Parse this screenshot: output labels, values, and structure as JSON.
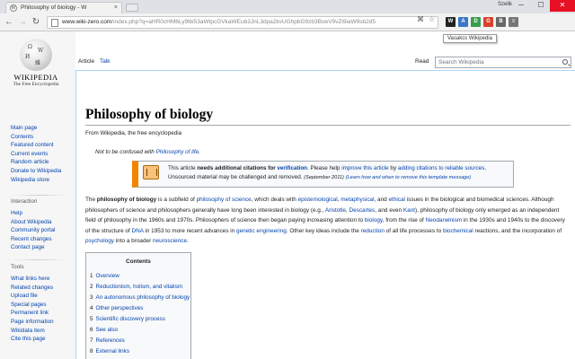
{
  "browser": {
    "tab_title": "Philosophy of biology - W",
    "tab_close": "×",
    "profile_name": "Szelik",
    "win_min": "─",
    "win_max": "☐",
    "win_close": "✕",
    "url_host": "www.wiki-zero.com",
    "url_path": "/index.php?q=aHR0cHM6Ly9lbi53aWtpcGVkaWEub3JnL3dpa2kvUGhpbG9zb3BoeV9vZl9iaW9sb2d5",
    "tooltip": "Vasakcs Wikipedia",
    "extensions": [
      {
        "label": "W",
        "color": "#222222"
      },
      {
        "label": "A",
        "color": "#3b77c8"
      },
      {
        "label": "D",
        "color": "#3a9c4d"
      },
      {
        "label": "G",
        "color": "#d9412a"
      },
      {
        "label": "B",
        "color": "#666666"
      },
      {
        "label": "≡",
        "color": "#777777"
      }
    ]
  },
  "sidebar": {
    "wordmark": "WIKIPEDIA",
    "tagline": "The Free Encyclopedia",
    "nav": [
      "Main page",
      "Contents",
      "Featured content",
      "Current events",
      "Random article",
      "Donate to Wikipedia",
      "Wikipedia store"
    ],
    "interaction_heading": "Interaction",
    "interaction": [
      "Help",
      "About Wikipedia",
      "Community portal",
      "Recent changes",
      "Contact page"
    ],
    "tools_heading": "Tools",
    "tools": [
      "What links here",
      "Related changes",
      "Upload file",
      "Special pages",
      "Permanent link",
      "Page information",
      "Wikidata item",
      "Cite this page"
    ]
  },
  "page_tabs": {
    "article": "Article",
    "talk": "Talk",
    "read": "Read",
    "search_placeholder": "Search Wikipedia"
  },
  "article": {
    "title": "Philosophy of biology",
    "from": "From Wikipedia, the free encyclopedia",
    "hatnote_prefix": "Not to be confused with ",
    "hatnote_link": "Philosophy of life",
    "hatnote_suffix": ".",
    "ambox": {
      "t1": "This article ",
      "t2": "needs additional citations for ",
      "t3": "verification",
      "t4": ". Please help ",
      "t5": "improve this article",
      "t6": " by ",
      "t7": "adding citations to reliable sources",
      "t8": ".",
      "line2": "Unsourced material may be challenged and removed.",
      "date": "(September 2011)",
      "learn": "(Learn how and when to remove this template message)"
    },
    "lead": {
      "s1": "The ",
      "s2": "philosophy of biology",
      "s3": " is a subfield of ",
      "s4": "philosophy of science",
      "s5": ", which deals with ",
      "s6": "epistemological",
      "s7": ", ",
      "s8": "metaphysical",
      "s9": ", and ",
      "s10": "ethical",
      "s11": " issues in the biological and biomedical sciences. Although philosophers of science and philosophers generally have long been interested in biology (e.g., ",
      "s12": "Aristotle",
      "s13": ", ",
      "s14": "Descartes",
      "s15": ", and even ",
      "s16": "Kant",
      "s17": "), philosophy of biology only emerged as an independent field of philosophy in the 1960s and 1970s. Philosophers of science then began paying increasing attention to ",
      "s18": "biology",
      "s19": ", from the rise of ",
      "s20": "Neodarwinism",
      "s21": " in the 1930s and 1940s to the discovery of the structure of ",
      "s22": "DNA",
      "s23": " in 1953 to more recent advances in ",
      "s24": "genetic engineering",
      "s25": ". Other key ideas include the ",
      "s26": "reduction",
      "s27": " of all life processes to ",
      "s28": "biochemical",
      "s29": " reactions, and the incorporation of ",
      "s30": "psychology",
      "s31": " into a broader ",
      "s32": "neuroscience",
      "s33": "."
    },
    "toc": {
      "title": "Contents",
      "items": [
        {
          "num": "1",
          "label": "Overview"
        },
        {
          "num": "2",
          "label": "Reductionism, holism, and vitalism"
        },
        {
          "num": "3",
          "label": "An autonomous philosophy of biology"
        },
        {
          "num": "4",
          "label": "Other perspectives"
        },
        {
          "num": "5",
          "label": "Scientific discovery process"
        },
        {
          "num": "6",
          "label": "See also"
        },
        {
          "num": "7",
          "label": "References"
        },
        {
          "num": "8",
          "label": "External links"
        }
      ]
    }
  }
}
